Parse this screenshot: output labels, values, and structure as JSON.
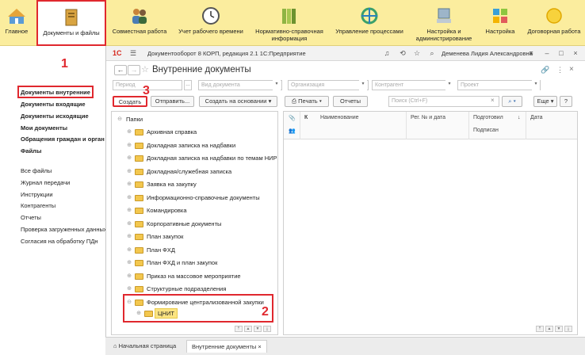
{
  "sections": [
    {
      "label": "Главное",
      "icon": "home-icon"
    },
    {
      "label": "Документы и файлы",
      "icon": "documents-icon"
    },
    {
      "label": "Совместная работа",
      "icon": "people-icon"
    },
    {
      "label": "Учет рабочего времени",
      "icon": "clock-icon"
    },
    {
      "label": "Нормативно-справочная информация",
      "icon": "books-icon"
    },
    {
      "label": "Управление процессами",
      "icon": "process-icon"
    },
    {
      "label": "Настройка и администрирование",
      "icon": "admin-icon"
    },
    {
      "label": "Настройка",
      "icon": "settings-icon"
    },
    {
      "label": "Договорная работа",
      "icon": "contract-icon"
    }
  ],
  "left_nav": {
    "bold_items": [
      "Документы внутренние",
      "Документы входящие",
      "Документы исходящие",
      "Мои документы",
      "Обращения граждан и орган",
      "Файлы"
    ],
    "items": [
      "Все файлы",
      "Журнал передачи",
      "Инструкции",
      "Контрагенты",
      "Отчеты",
      "Проверка загруженных данных",
      "Согласия на обработку ПДн"
    ]
  },
  "annotations": {
    "n1": "1",
    "n2": "2",
    "n3": "3"
  },
  "titlebar": {
    "logo": "1С",
    "app_title": "Документооборот 8 КОРП, редакция 2.1 1С:Предприятие",
    "user": "Деменева Лидия Александровна"
  },
  "header": {
    "title": "Внутренние документы"
  },
  "filters": {
    "period": "Период",
    "doc_type": "Вид документа",
    "organization": "Организация",
    "counterparty": "Контрагент",
    "project": "Проект"
  },
  "toolbar": {
    "create": "Создать",
    "send": "Отправить...",
    "create_based": "Создать на основании",
    "print": "Печать",
    "reports": "Отчеты",
    "search_placeholder": "Поиск (Ctrl+F)",
    "more": "Еще"
  },
  "tree": {
    "root": "Папки",
    "folders": [
      "Архивная справка",
      "Докладная записка на надбавки",
      "Докладная записка на надбавки по темам НИР",
      "Докладная/служебная записка",
      "Заявка на закупку",
      "Информационно-справочные документы",
      "Командировка",
      "Корпоративные документы",
      "План закупок",
      "План ФХД",
      "План ФХД и план закупок",
      "Приказ на массовое мероприятие",
      "Структурные подразделения",
      "Формирование централизованной закупки"
    ],
    "subfolder": "ЦНИТ"
  },
  "columns": {
    "k": "К",
    "name": "Наименование",
    "reg": "Рег. № и дата",
    "prepared": "Подготовил",
    "signed": "Подписан",
    "date": "Дата"
  },
  "bottom_tabs": {
    "home": "Начальная страница",
    "current": "Внутренние документы"
  }
}
